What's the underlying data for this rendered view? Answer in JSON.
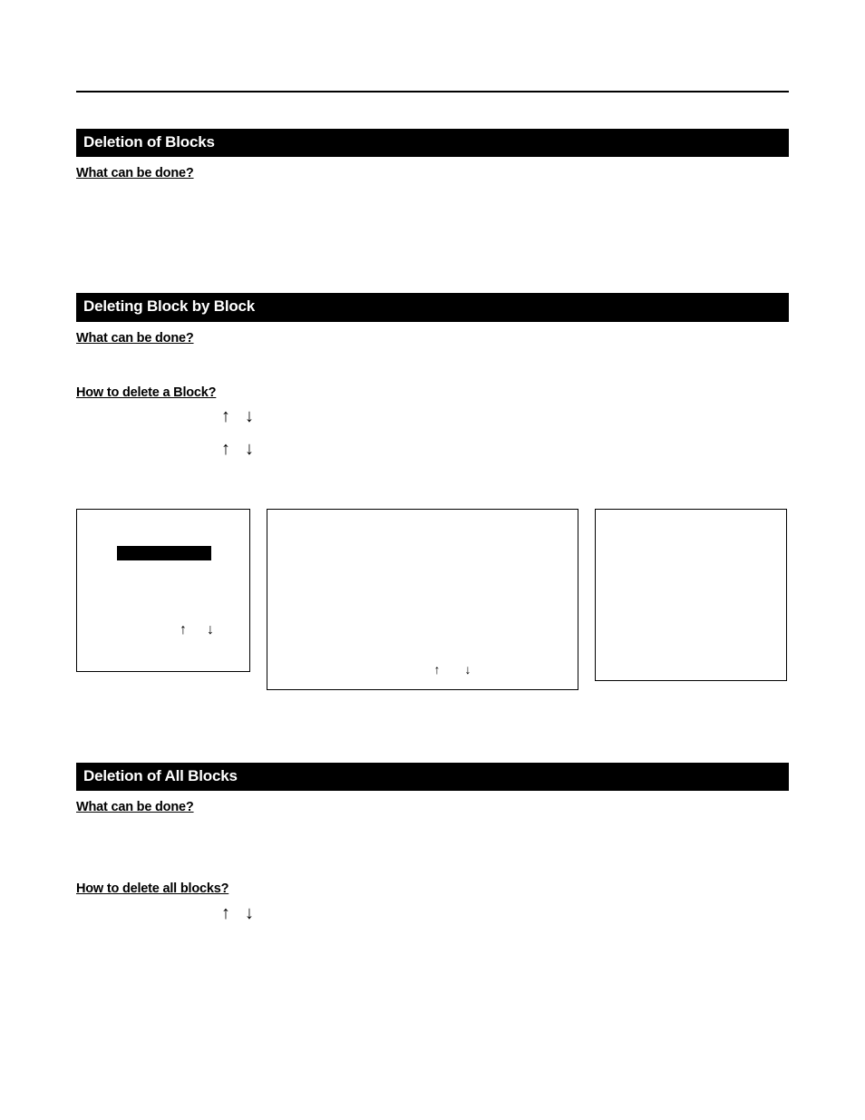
{
  "section1": {
    "title": "Deletion of Blocks",
    "q1": "What can be done?"
  },
  "section2": {
    "title": "Deleting Block by Block",
    "q1": "What can be done?",
    "q2": "How to delete a Block?"
  },
  "section3": {
    "title": "Deletion of All Blocks",
    "q1": "What can be done?",
    "q2": "How to delete all blocks?"
  }
}
